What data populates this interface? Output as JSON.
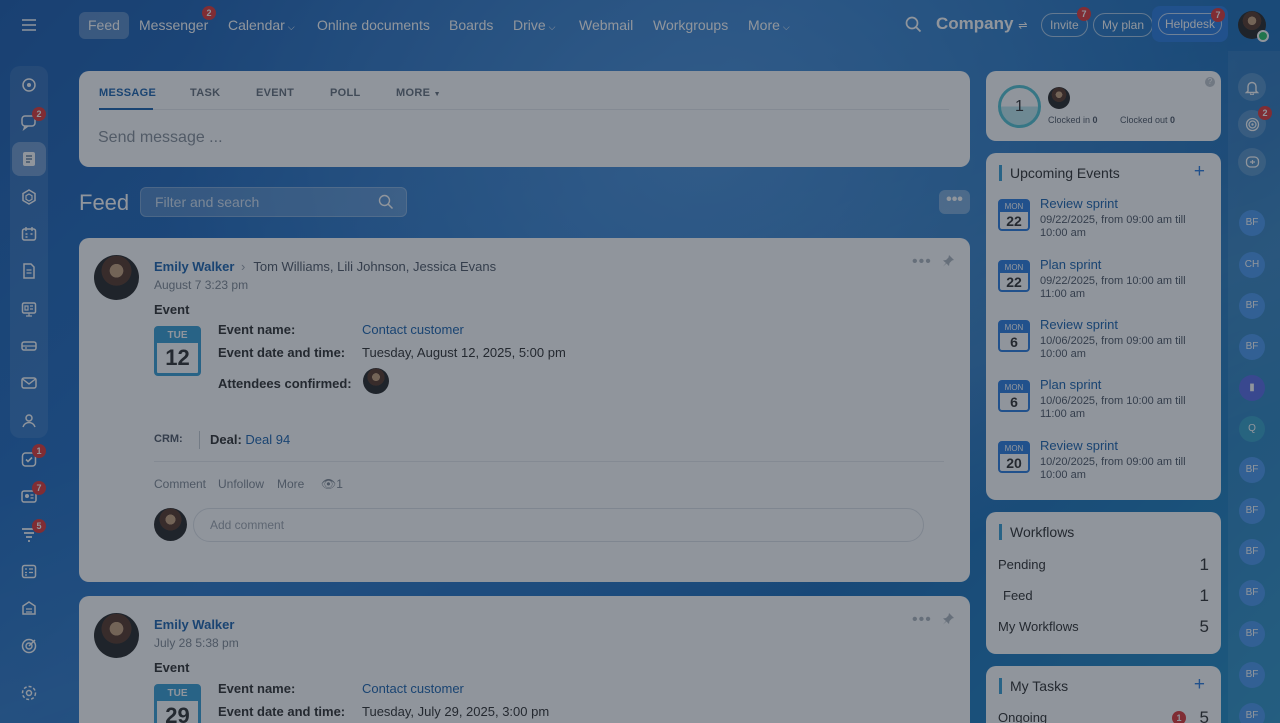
{
  "topbar": {
    "nav": [
      {
        "label": "Feed",
        "active": true
      },
      {
        "label": "Messenger",
        "badge": "2"
      },
      {
        "label": "Calendar",
        "dropdown": true
      },
      {
        "label": "Online documents"
      },
      {
        "label": "Boards"
      },
      {
        "label": "Drive",
        "dropdown": true
      },
      {
        "label": "Webmail"
      },
      {
        "label": "Workgroups"
      },
      {
        "label": "More",
        "dropdown": true
      }
    ],
    "company": "Company",
    "invite": "Invite",
    "invite_badge": "7",
    "my_plan": "My plan",
    "helpdesk": "Helpdesk",
    "helpdesk_badge": "7"
  },
  "left_rail": {
    "badges": {
      "chats": "2",
      "tasks": "1",
      "contacts": "7",
      "crm": "5"
    }
  },
  "composer": {
    "tabs": [
      "MESSAGE",
      "TASK",
      "EVENT",
      "POLL",
      "MORE"
    ],
    "placeholder": "Send message ..."
  },
  "feed": {
    "title": "Feed",
    "filter_placeholder": "Filter and search",
    "posts": [
      {
        "author": "Emily Walker",
        "recipients": "Tom Williams, Lili Johnson, Jessica Evans",
        "date": "August 7 3:23 pm",
        "kind": "Event",
        "cal_dow": "TUE",
        "cal_day": "12",
        "fields": [
          {
            "label": "Event name:",
            "value": "Contact customer"
          },
          {
            "label": "Event date and time:",
            "value": "Tuesday, August 12, 2025, 5:00 pm"
          },
          {
            "label": "Attendees confirmed:"
          }
        ],
        "crm_label": "CRM:",
        "deal_label": "Deal:",
        "deal_link": "Deal 94",
        "actions": [
          "Comment",
          "Unfollow",
          "More"
        ],
        "views": "1",
        "comment_placeholder": "Add comment"
      },
      {
        "author": "Emily Walker",
        "date": "July 28 5:38 pm",
        "kind": "Event",
        "cal_dow": "TUE",
        "cal_day": "29",
        "fields": [
          {
            "label": "Event name:",
            "value": "Contact customer"
          },
          {
            "label": "Event date and time:",
            "value": "Tuesday, July 29, 2025, 3:00 pm"
          }
        ]
      }
    ]
  },
  "timeman": {
    "count": "1",
    "clocked_in_label": "Clocked in",
    "clocked_in": "0",
    "clocked_out_label": "Clocked out",
    "clocked_out": "0"
  },
  "upcoming": {
    "title": "Upcoming Events",
    "events": [
      {
        "m": "MON",
        "d": "22",
        "title": "Review sprint",
        "time": "09/22/2025, from 09:00 am till 10:00 am"
      },
      {
        "m": "MON",
        "d": "22",
        "title": "Plan sprint",
        "time": "09/22/2025, from 10:00 am till 11:00 am"
      },
      {
        "m": "MON",
        "d": "6",
        "title": "Review sprint",
        "time": "10/06/2025, from 09:00 am till 10:00 am"
      },
      {
        "m": "MON",
        "d": "6",
        "title": "Plan sprint",
        "time": "10/06/2025, from 10:00 am till 11:00 am"
      },
      {
        "m": "MON",
        "d": "20",
        "title": "Review sprint",
        "time": "10/20/2025, from 09:00 am till 10:00 am"
      }
    ]
  },
  "workflows": {
    "title": "Workflows",
    "rows": [
      {
        "label": "Pending",
        "value": "1"
      },
      {
        "label": "Feed",
        "value": "1"
      },
      {
        "label": "My Workflows",
        "value": "5"
      }
    ]
  },
  "tasks": {
    "title": "My Tasks",
    "ongoing_label": "Ongoing",
    "ongoing_badge": "1",
    "ongoing_value": "5"
  },
  "right_rail": {
    "pulse_badge": "2",
    "avatars": [
      "BF",
      "CH",
      "BF",
      "BF",
      "",
      "Q",
      "BF",
      "BF",
      "BF",
      "BF",
      "BF",
      "BF",
      "BF"
    ]
  }
}
